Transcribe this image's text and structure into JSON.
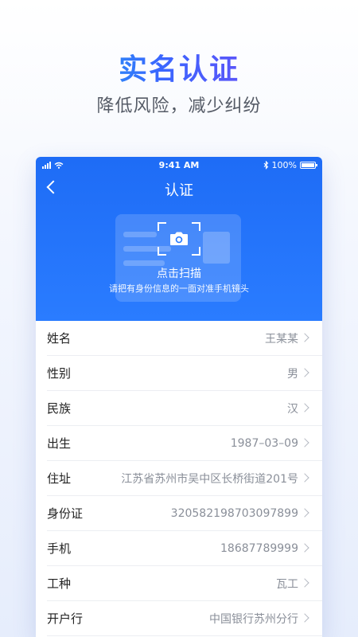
{
  "promo": {
    "title": "实名认证",
    "subtitle": "降低风险，减少纠纷"
  },
  "status_bar": {
    "time": "9:41 AM",
    "battery": "100%"
  },
  "nav": {
    "title": "认证"
  },
  "scan": {
    "label": "点击扫描",
    "hint": "请把有身份信息的一面对准手机镜头"
  },
  "fields": [
    {
      "label": "姓名",
      "value": "王某某"
    },
    {
      "label": "性别",
      "value": "男"
    },
    {
      "label": "民族",
      "value": "汉"
    },
    {
      "label": "出生",
      "value": "1987–03–09"
    },
    {
      "label": "住址",
      "value": "江苏省苏州市吴中区长桥街道201号"
    },
    {
      "label": "身份证",
      "value": "320582198703097899"
    },
    {
      "label": "手机",
      "value": "18687789999"
    },
    {
      "label": "工种",
      "value": "瓦工"
    },
    {
      "label": "开户行",
      "value": "中国银行苏州分行"
    }
  ],
  "colors": {
    "header_blue": "#1e6cf6",
    "title_gradient": [
      "#13c8e6",
      "#3a66ff",
      "#8a3cf0"
    ]
  }
}
